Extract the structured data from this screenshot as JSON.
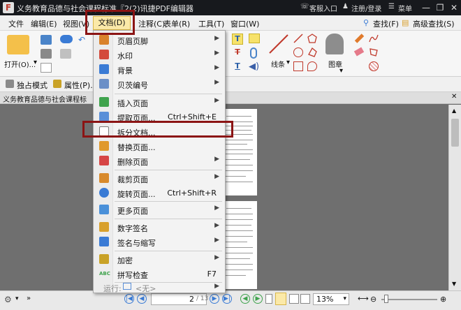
{
  "titlebar": {
    "app_icon": "F",
    "title": "义务教育品德与社会课程标准『2(2)讯捷PDF编辑器",
    "help": "客服入口",
    "account": "注册/登录",
    "menu": "菜单"
  },
  "menubar": {
    "items": [
      "文件",
      "编辑(E)",
      "视图(V)",
      "文档(D)",
      "注释(C)",
      "表单(R)",
      "工具(T)",
      "窗口(W)"
    ],
    "find": "查找(F)",
    "advanced_find": "高级查找(S)"
  },
  "ribbon": {
    "open": "打开(O)...",
    "lines": "线条",
    "stamp": "图章"
  },
  "toolbar2": {
    "exclusive_mode": "独占模式",
    "properties": "属性(P)..."
  },
  "tab": {
    "doc_title": "义务教育品德与社会课程标"
  },
  "dropdown": {
    "items": [
      {
        "label": "页眉页脚",
        "shortcut": "",
        "submenu": true,
        "icon": "header-footer-icon",
        "color": "#d9822b"
      },
      {
        "label": "水印",
        "shortcut": "",
        "submenu": true,
        "icon": "watermark-icon",
        "color": "#d34a3c"
      },
      {
        "label": "背景",
        "shortcut": "",
        "submenu": true,
        "icon": "background-icon",
        "color": "#3a7bd5"
      },
      {
        "label": "贝茨编号",
        "shortcut": "",
        "submenu": true,
        "icon": "bates-number-icon",
        "color": "#6b8fc7"
      },
      {
        "label": "插入页面",
        "shortcut": "",
        "submenu": true,
        "icon": "insert-page-icon",
        "color": "#3fa34d"
      },
      {
        "label": "提取页面...",
        "shortcut": "Ctrl+Shift+E",
        "submenu": false,
        "icon": "extract-page-icon",
        "color": "#5a8fd8"
      },
      {
        "label": "拆分文档...",
        "shortcut": "",
        "submenu": false,
        "icon": "split-document-icon",
        "color": "#7a7a7a"
      },
      {
        "label": "替换页面...",
        "shortcut": "",
        "submenu": false,
        "icon": "replace-page-icon",
        "color": "#e0992c"
      },
      {
        "label": "删除页面",
        "shortcut": "",
        "submenu": true,
        "icon": "delete-page-icon",
        "color": "#d64545"
      },
      {
        "label": "裁剪页面",
        "shortcut": "",
        "submenu": true,
        "icon": "crop-page-icon",
        "color": "#d88a2c"
      },
      {
        "label": "旋转页面...",
        "shortcut": "Ctrl+Shift+R",
        "submenu": false,
        "icon": "rotate-page-icon",
        "color": "#3a7bd5"
      },
      {
        "label": "更多页面",
        "shortcut": "",
        "submenu": true,
        "icon": "more-pages-icon",
        "color": "#4a90d9"
      },
      {
        "label": "数字签名",
        "shortcut": "",
        "submenu": true,
        "icon": "digital-signature-icon",
        "color": "#d8a02c"
      },
      {
        "label": "签名与缩写",
        "shortcut": "",
        "submenu": true,
        "icon": "sign-initials-icon",
        "color": "#3a7bd5"
      },
      {
        "label": "加密",
        "shortcut": "",
        "submenu": true,
        "icon": "encrypt-icon",
        "color": "#c9a227"
      },
      {
        "label": "拼写检查",
        "shortcut": "F7",
        "submenu": false,
        "icon": "spell-check-icon",
        "color": "#3fa34d"
      },
      {
        "label": "运行:",
        "shortcut": "<无>",
        "submenu": true,
        "icon": "run-icon",
        "color": "#5a8fd8"
      }
    ],
    "icon_abc": "ABC"
  },
  "statusbar": {
    "page_current": "2",
    "page_total": "/ 13",
    "zoom": "13%"
  },
  "colors": {
    "highlight": "#8b1414",
    "menu_active": "#fbe9a8",
    "titlebar": "#17191d"
  }
}
